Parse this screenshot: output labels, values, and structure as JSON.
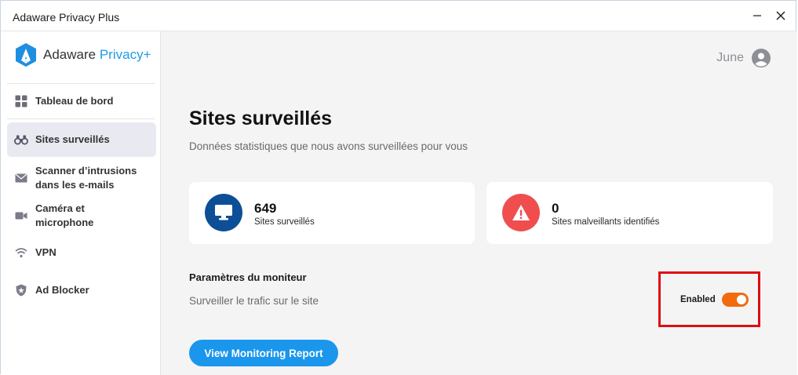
{
  "window": {
    "title": "Adaware Privacy Plus",
    "minimize_glyph": "—",
    "close_glyph": "✕"
  },
  "logo": {
    "brand": "Adaware",
    "product": "Privacy+"
  },
  "sidebar": {
    "items": [
      {
        "label": "Tableau de bord",
        "icon": "dashboard-icon"
      },
      {
        "label": "Sites surveillés",
        "icon": "binoculars-icon",
        "active": true
      },
      {
        "label_line1": "Scanner d’intrusions",
        "label_line2": "dans les e-mails",
        "icon": "mail-icon"
      },
      {
        "label_line1": "Caméra et",
        "label_line2": "microphone",
        "icon": "camera-icon"
      },
      {
        "label": "VPN",
        "icon": "wifi-icon"
      },
      {
        "label": "Ad Blocker",
        "icon": "shield-icon"
      }
    ]
  },
  "user": {
    "name": "June",
    "icon": "user-avatar-icon"
  },
  "page": {
    "title": "Sites surveillés",
    "subtitle": "Données statistiques que nous avons surveillées pour vous"
  },
  "stats": [
    {
      "value": "649",
      "label": "Sites surveillés",
      "icon": "monitor-icon",
      "color": "#0d4f96"
    },
    {
      "value": "0",
      "label": "Sites malveillants identifiés",
      "icon": "warning-icon",
      "color": "#f04e4e"
    }
  ],
  "settings": {
    "title": "Paramètres du moniteur",
    "description": "Surveiller le trafic sur le site",
    "toggle_label": "Enabled",
    "toggle_on": true
  },
  "report_button": "View Monitoring Report",
  "colors": {
    "accent": "#1a96ec",
    "toggle": "#f26b0f",
    "highlight_border": "#e00d14"
  }
}
